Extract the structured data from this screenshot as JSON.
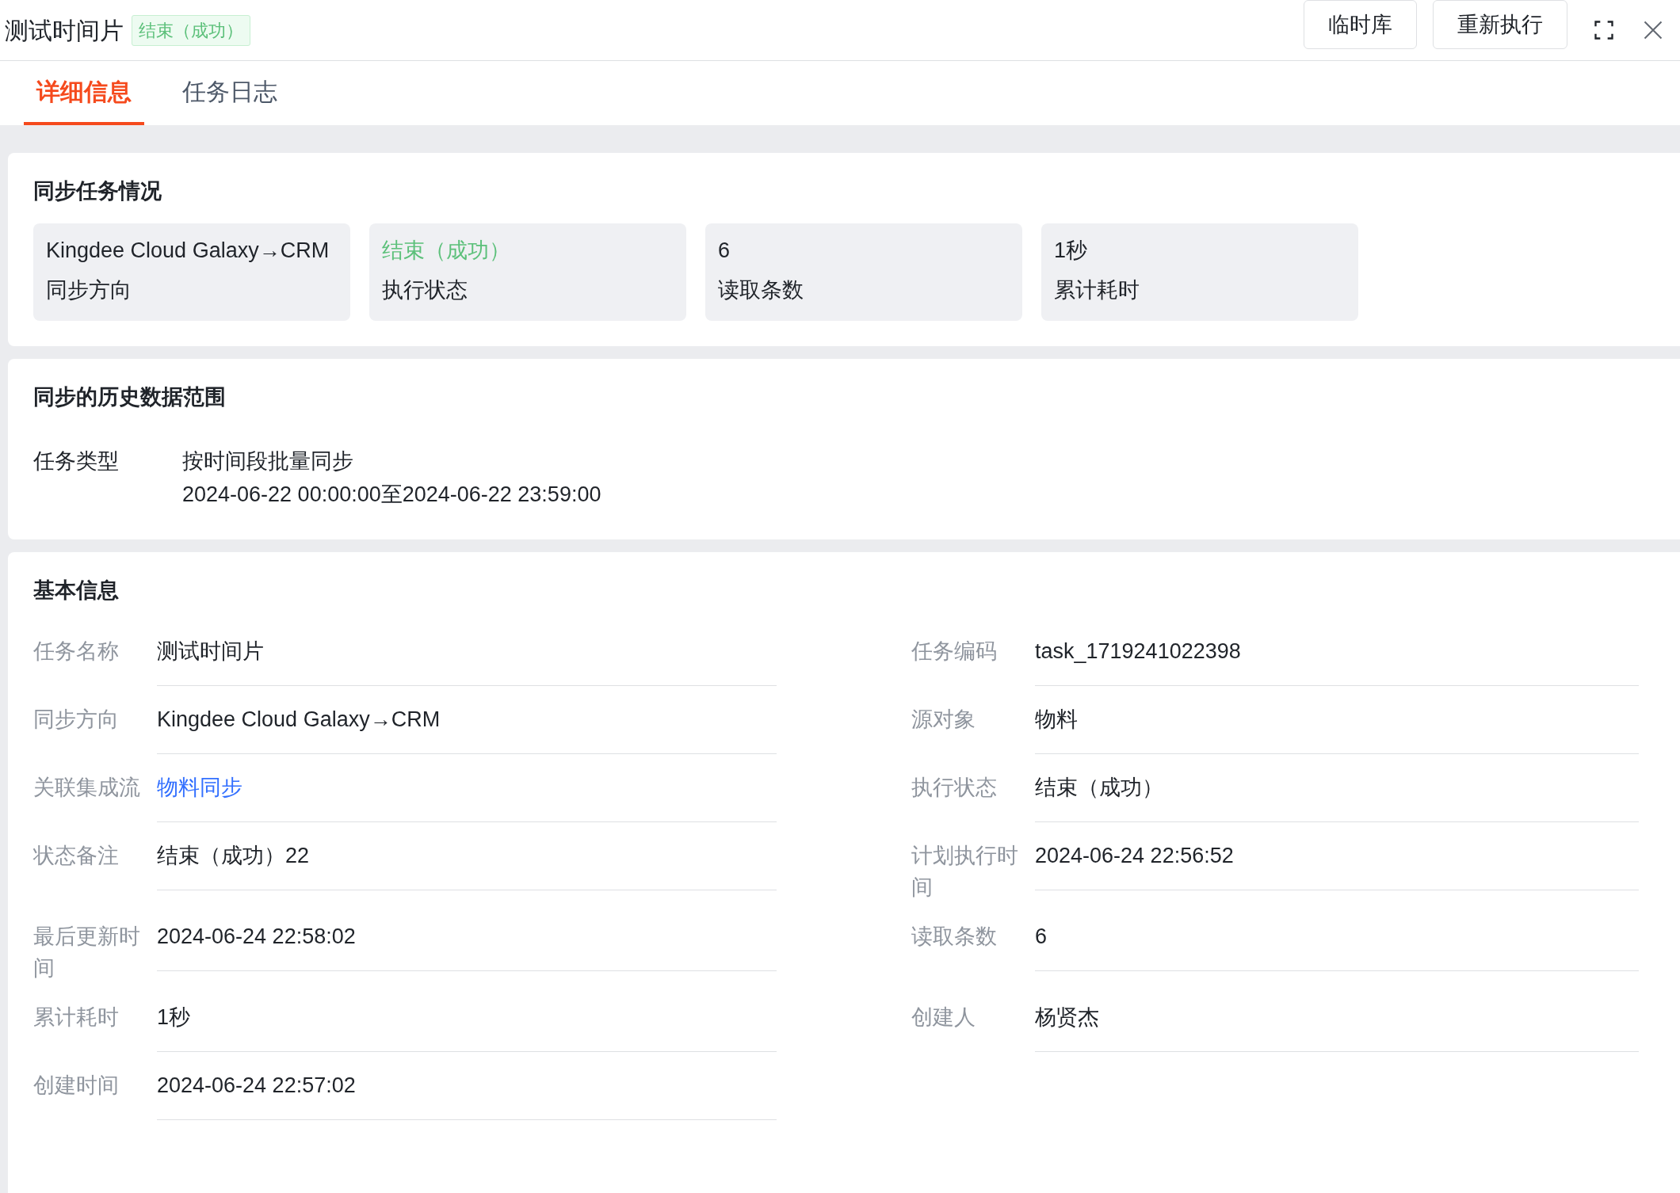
{
  "header": {
    "title": "测试时间片",
    "badge": {
      "label": "结束（成功）",
      "kind": "success"
    },
    "buttons": [
      "临时库",
      "重新执行"
    ]
  },
  "tabs": [
    {
      "label": "详细信息",
      "selected": true
    },
    {
      "label": "任务日志",
      "selected": false
    }
  ],
  "summary": {
    "title": "同步任务情况",
    "cards": [
      {
        "value": "Kingdee Cloud Galaxy→CRM",
        "label": "同步方向",
        "kind": "plain"
      },
      {
        "value": "结束（成功）",
        "label": "执行状态",
        "kind": "success"
      },
      {
        "value": "6",
        "label": "读取条数",
        "kind": "plain"
      },
      {
        "value": "1秒",
        "label": "累计耗时",
        "kind": "plain"
      }
    ]
  },
  "range": {
    "title": "同步的历史数据范围",
    "label": "任务类型",
    "lines": [
      "按时间段批量同步",
      "2024-06-22 00:00:00至2024-06-22 23:59:00"
    ]
  },
  "basic": {
    "title": "基本信息",
    "rows": [
      [
        {
          "label": "任务名称",
          "value": "测试时间片",
          "kind": "text"
        },
        {
          "label": "任务编码",
          "value": "task_1719241022398",
          "kind": "text"
        }
      ],
      [
        {
          "label": "同步方向",
          "value": "Kingdee Cloud Galaxy→CRM",
          "kind": "text"
        },
        {
          "label": "源对象",
          "value": "物料",
          "kind": "text"
        }
      ],
      [
        {
          "label": "关联集成流",
          "value": "物料同步",
          "kind": "link"
        },
        {
          "label": "执行状态",
          "value": "结束（成功）",
          "kind": "text"
        }
      ],
      [
        {
          "label": "状态备注",
          "value": "结束（成功）22",
          "kind": "text"
        },
        {
          "label": "计划执行时间",
          "value": "2024-06-24 22:56:52",
          "kind": "text"
        }
      ],
      [
        {
          "label": "最后更新时间",
          "value": "2024-06-24 22:58:02",
          "kind": "text"
        },
        {
          "label": "读取条数",
          "value": "6",
          "kind": "text"
        }
      ],
      [
        {
          "label": "累计耗时",
          "value": "1秒",
          "kind": "text"
        },
        {
          "label": "创建人",
          "value": "杨贤杰",
          "kind": "text"
        }
      ],
      [
        {
          "label": "创建时间",
          "value": "2024-06-24 22:57:02",
          "kind": "text"
        }
      ]
    ]
  }
}
